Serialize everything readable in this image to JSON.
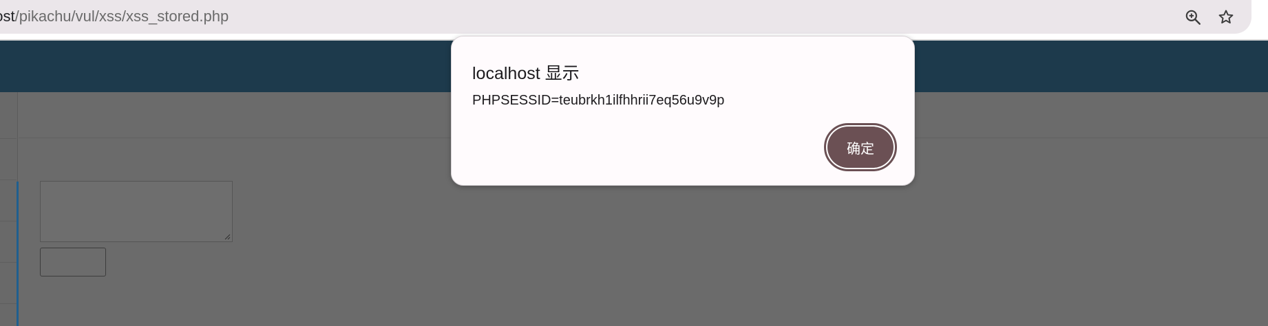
{
  "browser": {
    "url_host": "host",
    "url_path": "/pikachu/vul/xss/xss_stored.php",
    "icons": [
      "zoom-icon",
      "star-icon"
    ]
  },
  "page": {
    "header_color": "#1d3a4c",
    "textarea_value": "",
    "submit_label": ""
  },
  "dialog": {
    "title": "localhost 显示",
    "message": "PHPSESSID=teubrkh1ilfhhrii7eq56u9v9p",
    "ok_label": "确定",
    "accent_color": "#6b5054"
  }
}
